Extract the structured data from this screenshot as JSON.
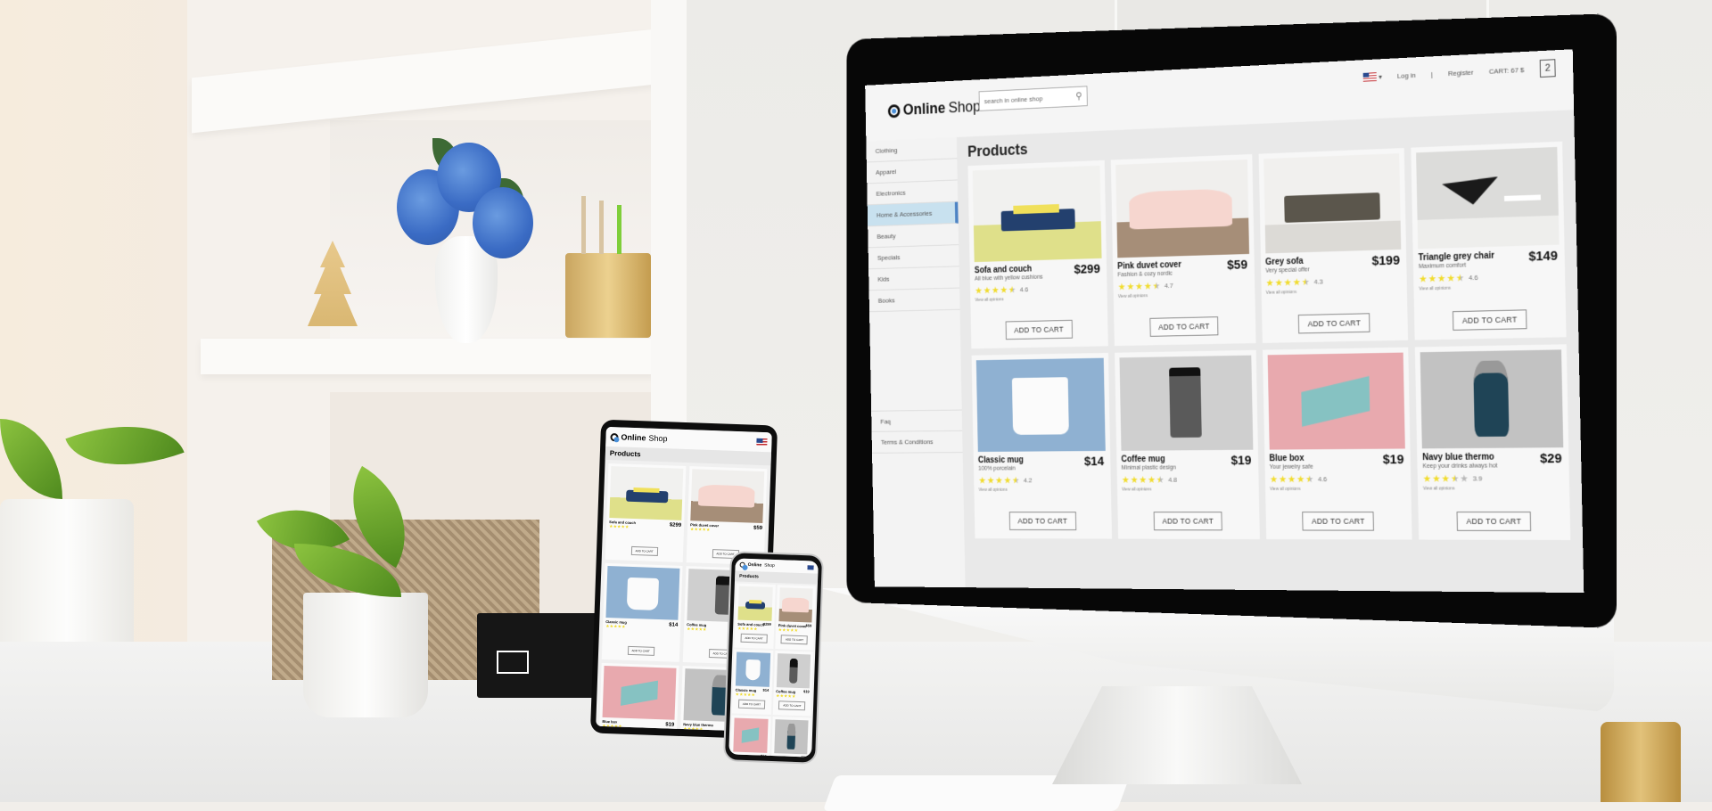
{
  "scene": {
    "description": "Desk with iMac, tablet and phone displaying responsive online shop",
    "colors": {
      "accent_active": "#c8e1ef",
      "accent_bar": "#4d83c4",
      "star": "#f1dc2f",
      "star_off": "#b9b9b9",
      "bezel": "#070707"
    }
  },
  "shop": {
    "logo": {
      "bold": "Online",
      "light": "Shop",
      "icon": "logo-circle-icon"
    },
    "search": {
      "placeholder": "search in online shop",
      "icon": "search-icon"
    },
    "header": {
      "language_flag": "us-flag-icon",
      "login": "Log in",
      "separator": "|",
      "register": "Register",
      "cart_label": "CART: 67 $",
      "cart_count": "2",
      "cart_icon": "shopping-bag-icon"
    },
    "sidebar": {
      "categories": [
        {
          "label": "Clothing",
          "active": false
        },
        {
          "label": "Apparel",
          "active": false
        },
        {
          "label": "Electronics",
          "active": false
        },
        {
          "label": "Home & Accessories",
          "active": true
        },
        {
          "label": "Beauty",
          "active": false
        },
        {
          "label": "Specials",
          "active": false
        },
        {
          "label": "Kids",
          "active": false
        },
        {
          "label": "Books",
          "active": false
        }
      ],
      "footer_links": [
        {
          "label": "Faq"
        },
        {
          "label": "Terms & Conditions"
        }
      ]
    },
    "page_title": "Products",
    "add_to_cart_label": "ADD TO CART",
    "view_opinions_label": "View all opinions",
    "products": [
      {
        "name": "Sofa and couch",
        "subtitle": "All blue with yellow cushions",
        "price": "$299",
        "rating": 4.6,
        "rating_text": "4.6",
        "image": "blue-sofa"
      },
      {
        "name": "Pink duvet cover",
        "subtitle": "Fashion & cozy nordic",
        "price": "$59",
        "rating": 4.7,
        "rating_text": "4.7",
        "image": "pink-bed"
      },
      {
        "name": "Grey sofa",
        "subtitle": "Very special offer",
        "price": "$199",
        "rating": 4.3,
        "rating_text": "4.3",
        "image": "grey-sofa"
      },
      {
        "name": "Triangle grey chair",
        "subtitle": "Maximum comfort",
        "price": "$149",
        "rating": 4.6,
        "rating_text": "4.6",
        "image": "black-chair"
      },
      {
        "name": "Classic mug",
        "subtitle": "100% porcelain",
        "price": "$14",
        "rating": 4.2,
        "rating_text": "4.2",
        "image": "white-mug"
      },
      {
        "name": "Coffee mug",
        "subtitle": "Minimal plastic design",
        "price": "$19",
        "rating": 4.8,
        "rating_text": "4.8",
        "image": "coffee-cup"
      },
      {
        "name": "Blue box",
        "subtitle": "Your jewelry safe",
        "price": "$19",
        "rating": 4.6,
        "rating_text": "4.6",
        "image": "teal-box"
      },
      {
        "name": "Navy blue thermo",
        "subtitle": "Keep your drinks always hot",
        "price": "$29",
        "rating": 3.9,
        "rating_text": "3.9",
        "image": "thermo-bottle"
      }
    ]
  }
}
